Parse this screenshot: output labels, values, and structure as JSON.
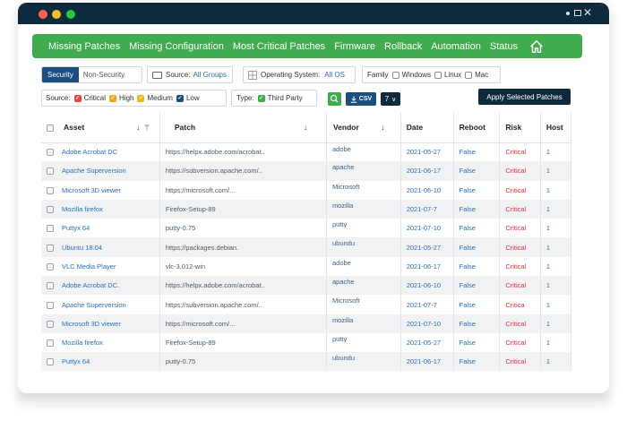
{
  "nav": {
    "items": [
      "Missing Patches",
      "Missing Configuration",
      "Most Critical Patches",
      "Firmware",
      "Rollback",
      "Automation",
      "Status"
    ],
    "home_icon": "home-icon"
  },
  "filters": {
    "security_active": "Security",
    "security_inactive": "Non-Security",
    "source_label": "Source:",
    "source_value": "All Groups",
    "os_label": "Operating System:",
    "os_value": "All OS",
    "family_label": "Family",
    "family_options": [
      "Windows",
      "Linux",
      "Mac"
    ],
    "severity_label": "Source:",
    "severity_options": [
      "Critical",
      "High",
      "Medium",
      "Low"
    ],
    "type_label": "Type:",
    "type_value": "Third Party",
    "csv_label": "CSV",
    "page_size": "7",
    "apply_label": "Apply Selected Patches"
  },
  "table": {
    "columns": [
      "Asset",
      "Patch",
      "Vendor",
      "Date",
      "Reboot",
      "Risk",
      "Host"
    ],
    "rows": [
      [
        "Adobe Acrobat DC",
        "https://helpx.adobe.com/acrobat..",
        "adobe",
        "2021-05-27",
        "False",
        "Critical",
        "1"
      ],
      [
        "Apache Superversion",
        "https://subversion.apache.com/..",
        "apache",
        "2021-06-17",
        "False",
        "Critical",
        "1"
      ],
      [
        "Microsoft 3D viewer",
        "https://microsoft.com/...",
        "Microsoft",
        "2021-06-10",
        "False",
        "Critical",
        "1"
      ],
      [
        "Mozilla firefox",
        "Firefox-Setup-89",
        "mozilla",
        "2021-07-7",
        "False",
        "Critical",
        "1"
      ],
      [
        "Puttyx 64",
        "putty-0.75",
        "putty",
        "2021-07-10",
        "False",
        "Critical",
        "1"
      ],
      [
        "Ubuntu 18.04",
        "https://packages.debian.",
        "ubundu",
        "2021-05-27",
        "False",
        "Critical",
        "1"
      ],
      [
        "VLC Media Player",
        "vlc-3.012-win",
        "adobe",
        "2021-06-17",
        "False",
        "Critical",
        "1"
      ],
      [
        "Adobe Acrobat DC.",
        "https://helpx.adobe.com/acrobat..",
        "apache",
        "2021-06-10",
        "False",
        "Critical",
        "1"
      ],
      [
        "Apache Superversion",
        "https://subversion.apache.com/..",
        "Microsoft",
        "2021-07-7",
        "False",
        "Critica",
        "1"
      ],
      [
        "Microsoft 3D viewer",
        "https://microsoft.com/...",
        "mozilla",
        "2021-07-10",
        "False",
        "Critical",
        "1"
      ],
      [
        "Mozilla firefox",
        "Firefox-Setup-89",
        "putty",
        "2021-05-27",
        "False",
        "Critical",
        "1"
      ],
      [
        "Puttyx 64",
        "putty-0.75",
        "ubundu",
        "2021-06-17",
        "False",
        "Critical",
        "1"
      ]
    ]
  },
  "colors": {
    "nav_green": "#3fac4f",
    "title_navy": "#0d2b3c",
    "active_blue": "#1a4f80",
    "link_blue": "#2a6ebd",
    "risk_red": "#e0303a"
  }
}
